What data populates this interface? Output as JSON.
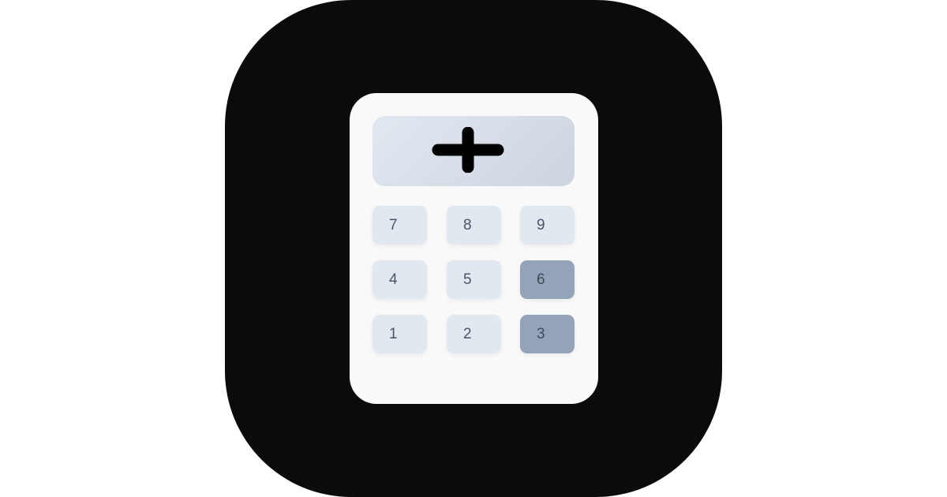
{
  "colors": {
    "icon_background": "#0b0b0d",
    "calculator_body": "#f9f9f9",
    "display_gradient_start": "#e2e8f0",
    "display_gradient_end": "#cdd4e1",
    "key": "#e2e8f0",
    "key_highlighted": "#94a3b8",
    "key_text": "#4a5568",
    "plus_symbol": "#000000"
  },
  "display": {
    "icon": "plus-icon"
  },
  "keys": {
    "k7": "7",
    "k8": "8",
    "k9": "9",
    "k4": "4",
    "k5": "5",
    "k6": "6",
    "k1": "1",
    "k2": "2",
    "k3": "3"
  },
  "highlighted_keys": [
    "6",
    "3"
  ]
}
